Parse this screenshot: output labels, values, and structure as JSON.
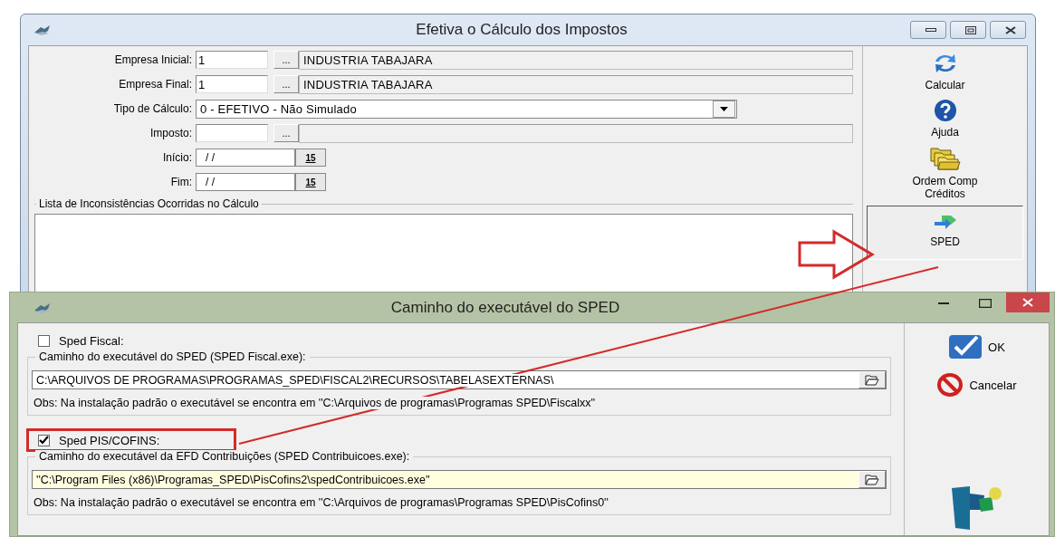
{
  "main_window": {
    "title": "Efetiva o Cálculo dos Impostos",
    "fields": [
      {
        "kind": "lookup",
        "label": "Empresa Inicial:",
        "value": "1",
        "button": "...",
        "description": "INDUSTRIA TABAJARA"
      },
      {
        "kind": "lookup",
        "label": "Empresa Final:",
        "value": "1",
        "button": "...",
        "description": "INDUSTRIA TABAJARA"
      },
      {
        "kind": "dropdown",
        "label": "Tipo de Cálculo:",
        "value": "0 - EFETIVO - Não Simulado"
      },
      {
        "kind": "lookup",
        "label": "Imposto:",
        "button": "..."
      },
      {
        "kind": "date",
        "label": "Início:",
        "value": "/ /",
        "calendar": "15"
      },
      {
        "kind": "date",
        "label": "Fim:",
        "value": "/ /",
        "calendar": "15"
      }
    ],
    "inconsistencies": {
      "title": "Lista de Inconsistências Ocorridas no Cálculo"
    },
    "toolbar": [
      {
        "kind": "refresh",
        "label": "Calcular",
        "selected": false
      },
      {
        "kind": "help",
        "label": "Ajuda",
        "selected": false
      },
      {
        "kind": "folders",
        "label": "Ordem Comp Créditos",
        "selected": false
      },
      {
        "kind": "sped",
        "label": "SPED",
        "selected": true
      }
    ]
  },
  "dialog": {
    "title": "Caminho do executável do SPED",
    "sections": [
      {
        "checkbox": "Sped Fiscal:",
        "checked": false,
        "highlighted": false,
        "group_title": "Caminho do executável do SPED (SPED Fiscal.exe):",
        "path": "C:\\ARQUIVOS DE PROGRAMAS\\PROGRAMAS_SPED\\FISCAL2\\RECURSOS\\TABELASEXTERNAS\\",
        "focused": false,
        "note": "Obs: Na instalação padrão o executável se encontra em ''C:\\Arquivos de programas\\Programas SPED\\Fiscalxx''"
      },
      {
        "checkbox": "Sped PIS/COFINS:",
        "checked": true,
        "highlighted": true,
        "group_title": "Caminho do executável da EFD Contribuições (SPED Contribuicoes.exe):",
        "path": "''C:\\Program Files (x86)\\Programas_SPED\\PisCofins2\\spedContribuicoes.exe''",
        "focused": true,
        "note": "Obs: Na instalação padrão o executável se encontra em ''C:\\Arquivos de programas\\Programas SPED\\PisCofins0''"
      }
    ],
    "buttons": [
      {
        "kind": "ok",
        "label": "OK"
      },
      {
        "kind": "cancel",
        "label": "Cancelar"
      }
    ]
  }
}
